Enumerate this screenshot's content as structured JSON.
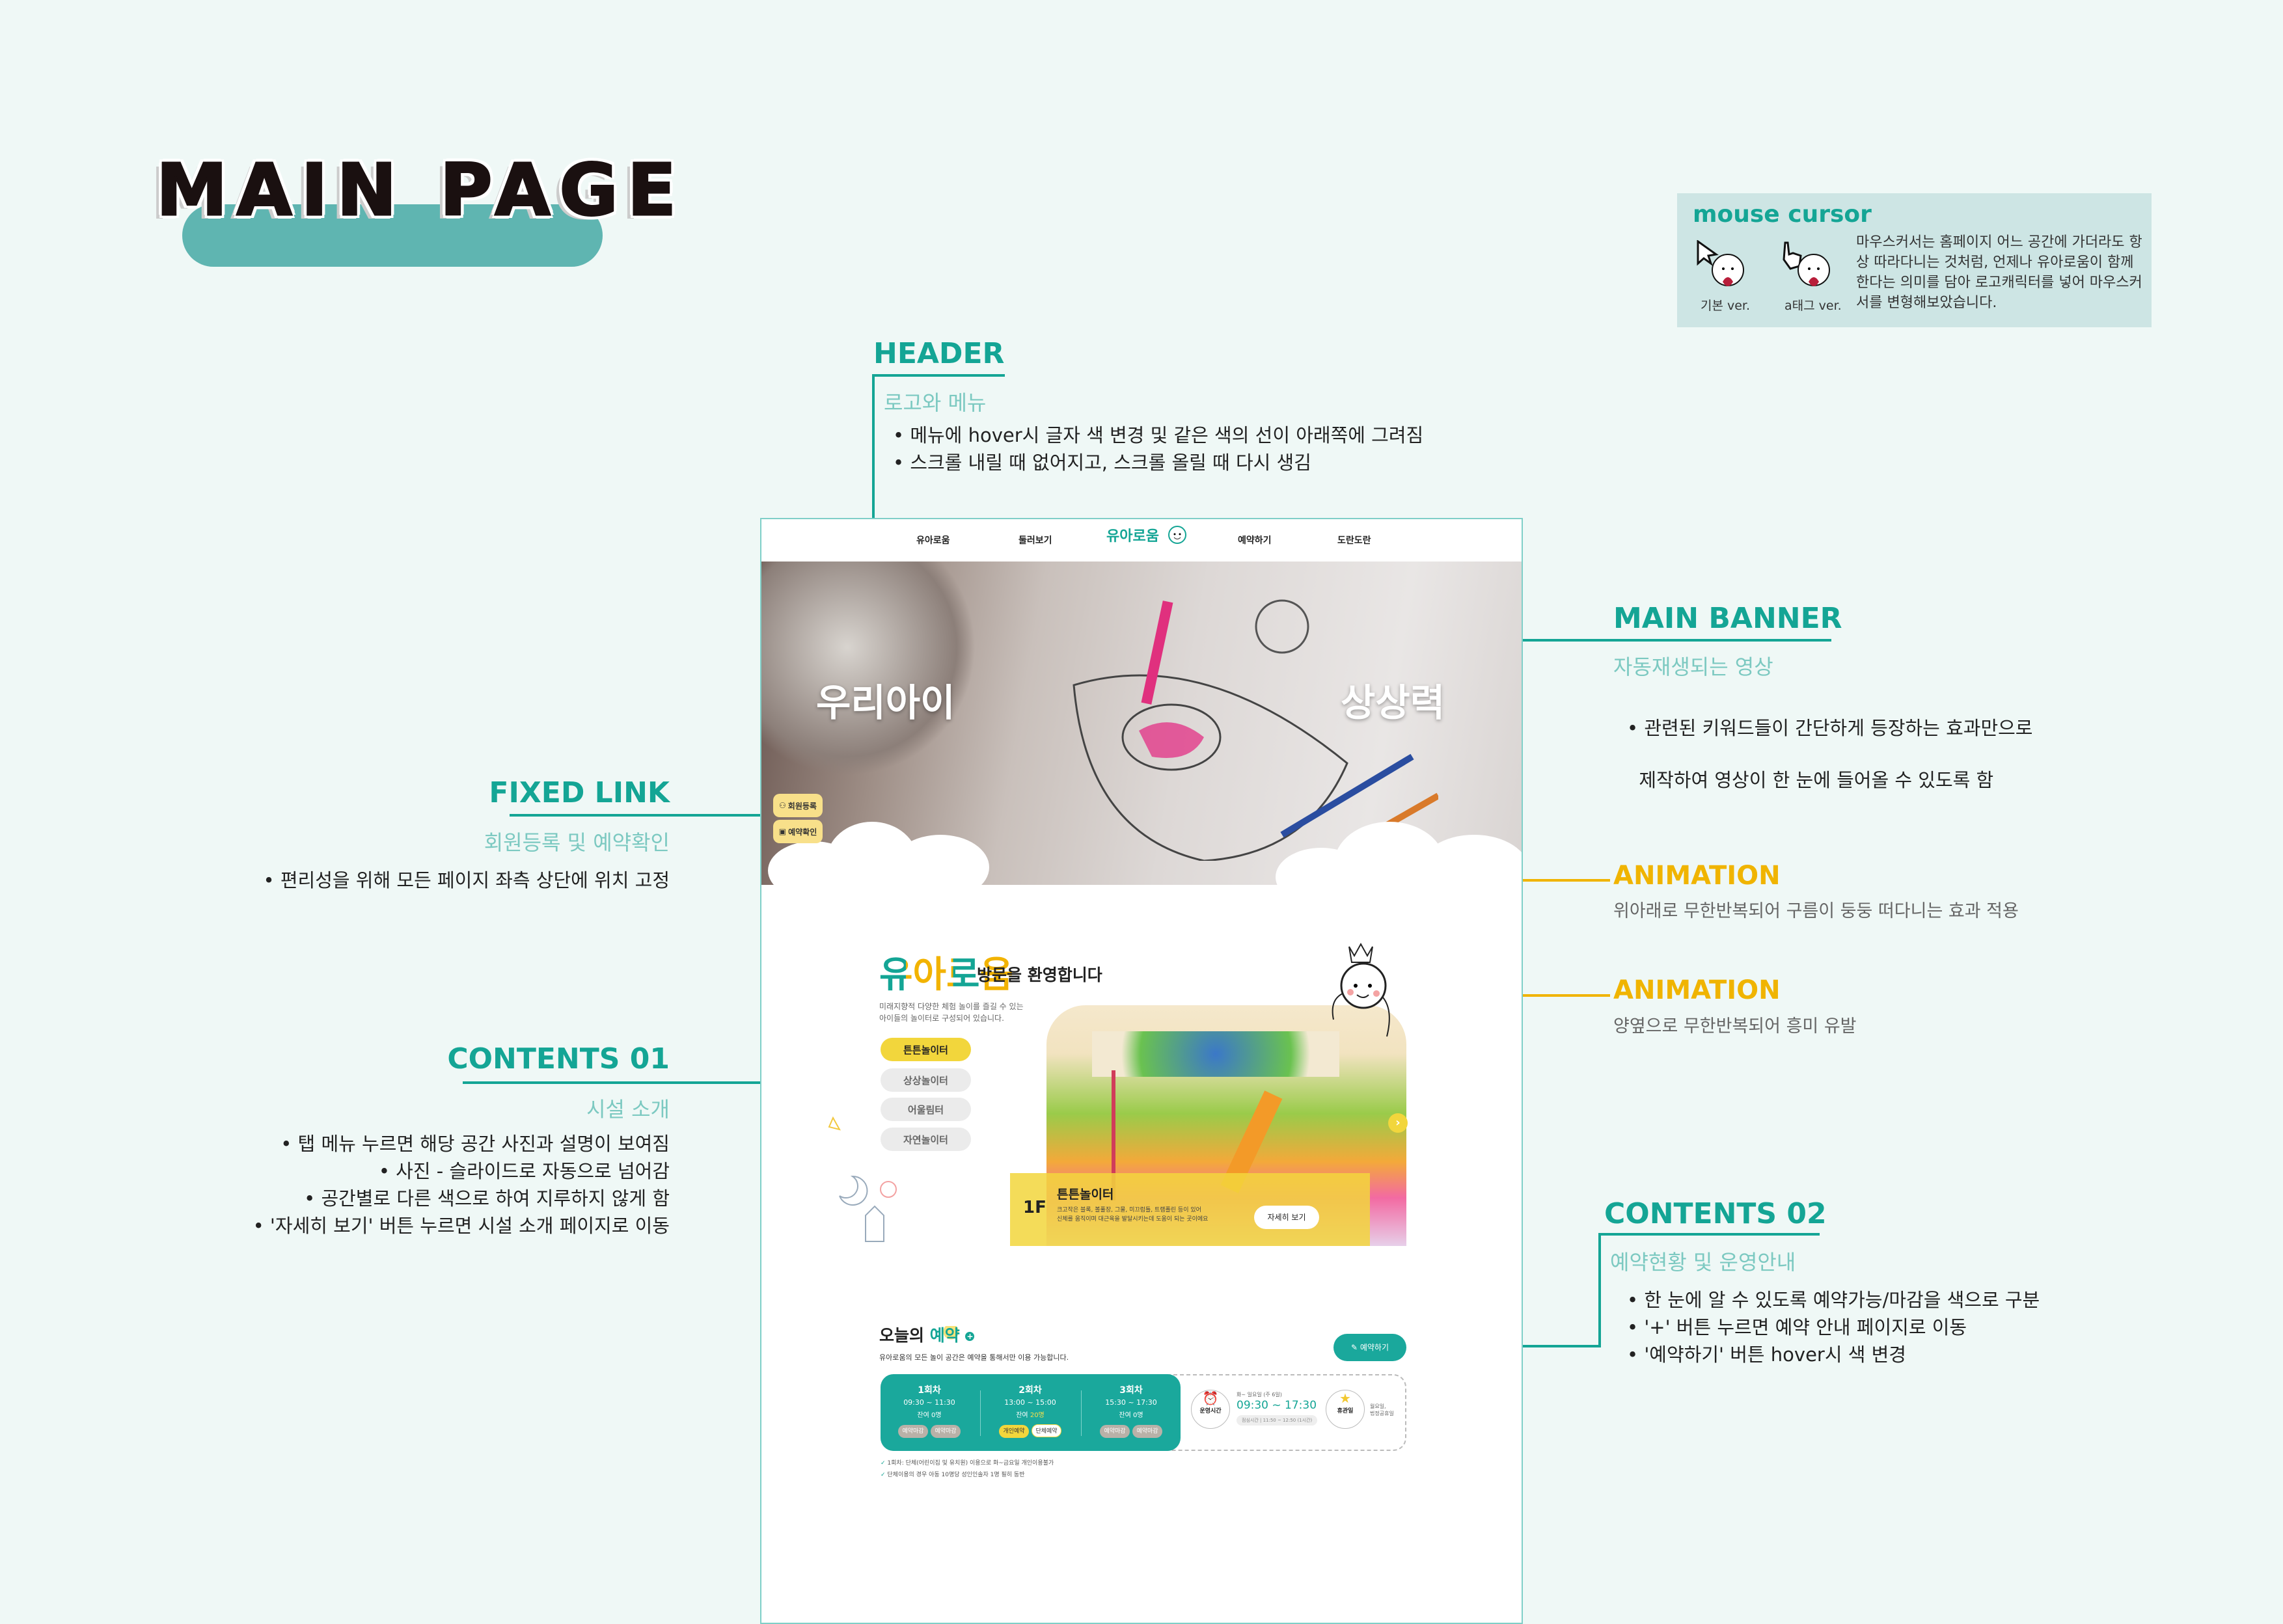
{
  "title": "MAIN PAGE",
  "colors": {
    "teal": "#14a595",
    "yellow": "#f0b400",
    "background": "#eff8f6",
    "mock_teal": "#1aa89c",
    "tab_active": "#f2d63c"
  },
  "mouse_cursor": {
    "heading": "mouse cursor",
    "default_caption": "기본 ver.",
    "link_caption": "a태그 ver.",
    "description": "마우스커서는 홈페이지 어느 공간에 가더라도 항상 따라다니는 것처럼, 언제나 유아로움이 함께한다는 의미를 담아 로고캐릭터를 넣어 마우스커서를 변형해보았습니다."
  },
  "annotations": {
    "header": {
      "label": "HEADER",
      "sub": "로고와 메뉴",
      "bullets": [
        "• 메뉴에 hover시 글자 색 변경 및 같은 색의 선이 아래쪽에 그려짐",
        "• 스크롤 내릴 때 없어지고, 스크롤 올릴 때 다시 생김"
      ]
    },
    "main_banner": {
      "label": "MAIN BANNER",
      "sub": "자동재생되는 영상",
      "bullets": [
        "• 관련된 키워드들이 간단하게 등장하는 효과만으로",
        "  제작하여 영상이 한 눈에 들어올 수 있도록 함"
      ]
    },
    "fixed_link": {
      "label": "FIXED LINK",
      "sub": "회원등록 및 예약확인",
      "bullets": [
        "• 편리성을 위해 모든 페이지 좌측 상단에 위치 고정"
      ]
    },
    "animation_1": {
      "label": "ANIMATION",
      "sub": "위아래로 무한반복되어 구름이 둥둥 떠다니는 효과 적용"
    },
    "animation_2": {
      "label": "ANIMATION",
      "sub": "양옆으로 무한반복되어 흥미 유발"
    },
    "contents_01": {
      "label": "CONTENTS 01",
      "sub": "시설 소개",
      "bullets": [
        "• 탭 메뉴 누르면 해당 공간 사진과 설명이 보여짐",
        "• 사진 - 슬라이드로 자동으로 넘어감",
        "• 공간별로 다른 색으로 하여 지루하지 않게 함",
        "• '자세히 보기' 버튼 누르면 시설 소개 페이지로 이동"
      ]
    },
    "contents_02": {
      "label": "CONTENTS 02",
      "sub": "예약현황 및 운영안내",
      "bullets": [
        "• 한 눈에 알 수 있도록 예약가능/마감을 색으로 구분",
        "• '+' 버튼 누르면 예약 안내 페이지로 이동",
        "• '예약하기' 버튼 hover시 색 변경"
      ]
    }
  },
  "mock": {
    "nav": [
      "유아로움",
      "둘러보기",
      "예약하기",
      "도란도란"
    ],
    "logo": "유아로움",
    "banner": {
      "word_left": "우리아이",
      "word_right": "상상력"
    },
    "fixed_links": [
      "회원등록",
      "예약확인"
    ],
    "welcome": {
      "logo": "유아로움",
      "title": "방문을 환영합니다",
      "desc": [
        "미래지향적 다양한 체험 놀이를 즐길 수 있는",
        "아이들의 놀이터로 구성되어 있습니다."
      ],
      "tabs": [
        "튼튼놀이터",
        "상상놀이터",
        "어울림터",
        "자연놀이터"
      ],
      "active_tab": 0,
      "floor": "1F",
      "space_name": "튼튼놀이터",
      "space_desc": [
        "크고작은 블록, 볼풀장, 그물, 미끄럼틀, 트램폴린 등이 있어",
        "신체를 움직이며 대근육을 발달시키는데 도움이 되는 곳이에요"
      ],
      "detail_button": "자세히 보기"
    },
    "reservation": {
      "title_a": "오늘의",
      "title_b": "예약",
      "desc": "유아로움의 모든 놀이 공간은 예약을 통해서만 이용 가능합니다.",
      "button": "예약하기",
      "slots": [
        {
          "name": "1회차",
          "time": "09:30 ~ 11:30",
          "remain_label": "잔여",
          "remain": "0명",
          "buttons": [
            "예약마감",
            "예약마감"
          ]
        },
        {
          "name": "2회차",
          "time": "13:00 ~ 15:00",
          "remain_label": "잔여",
          "remain": "20명",
          "buttons": [
            "개인예약",
            "단체예약"
          ]
        },
        {
          "name": "3회차",
          "time": "15:30 ~ 17:30",
          "remain_label": "잔여",
          "remain": "0명",
          "buttons": [
            "예약마감",
            "예약마감"
          ]
        }
      ],
      "hours_label": "운영시간",
      "hours_days": "화~ 일요일 (주 6일)",
      "hours": "09:30 ~ 17:30",
      "lunch": "점심시간 | 11:50 ~ 12:50 (1시간)",
      "closed_label": "휴관일",
      "closed_days": [
        "월요일,",
        "법정공휴일"
      ],
      "notes": [
        "1회차: 단체(어린이집 및 유치원) 이용으로 화~금요일 개인이용불가",
        "단체이용의 경우 아동 10명당 성인인솔자 1명 필히 동반"
      ]
    }
  }
}
